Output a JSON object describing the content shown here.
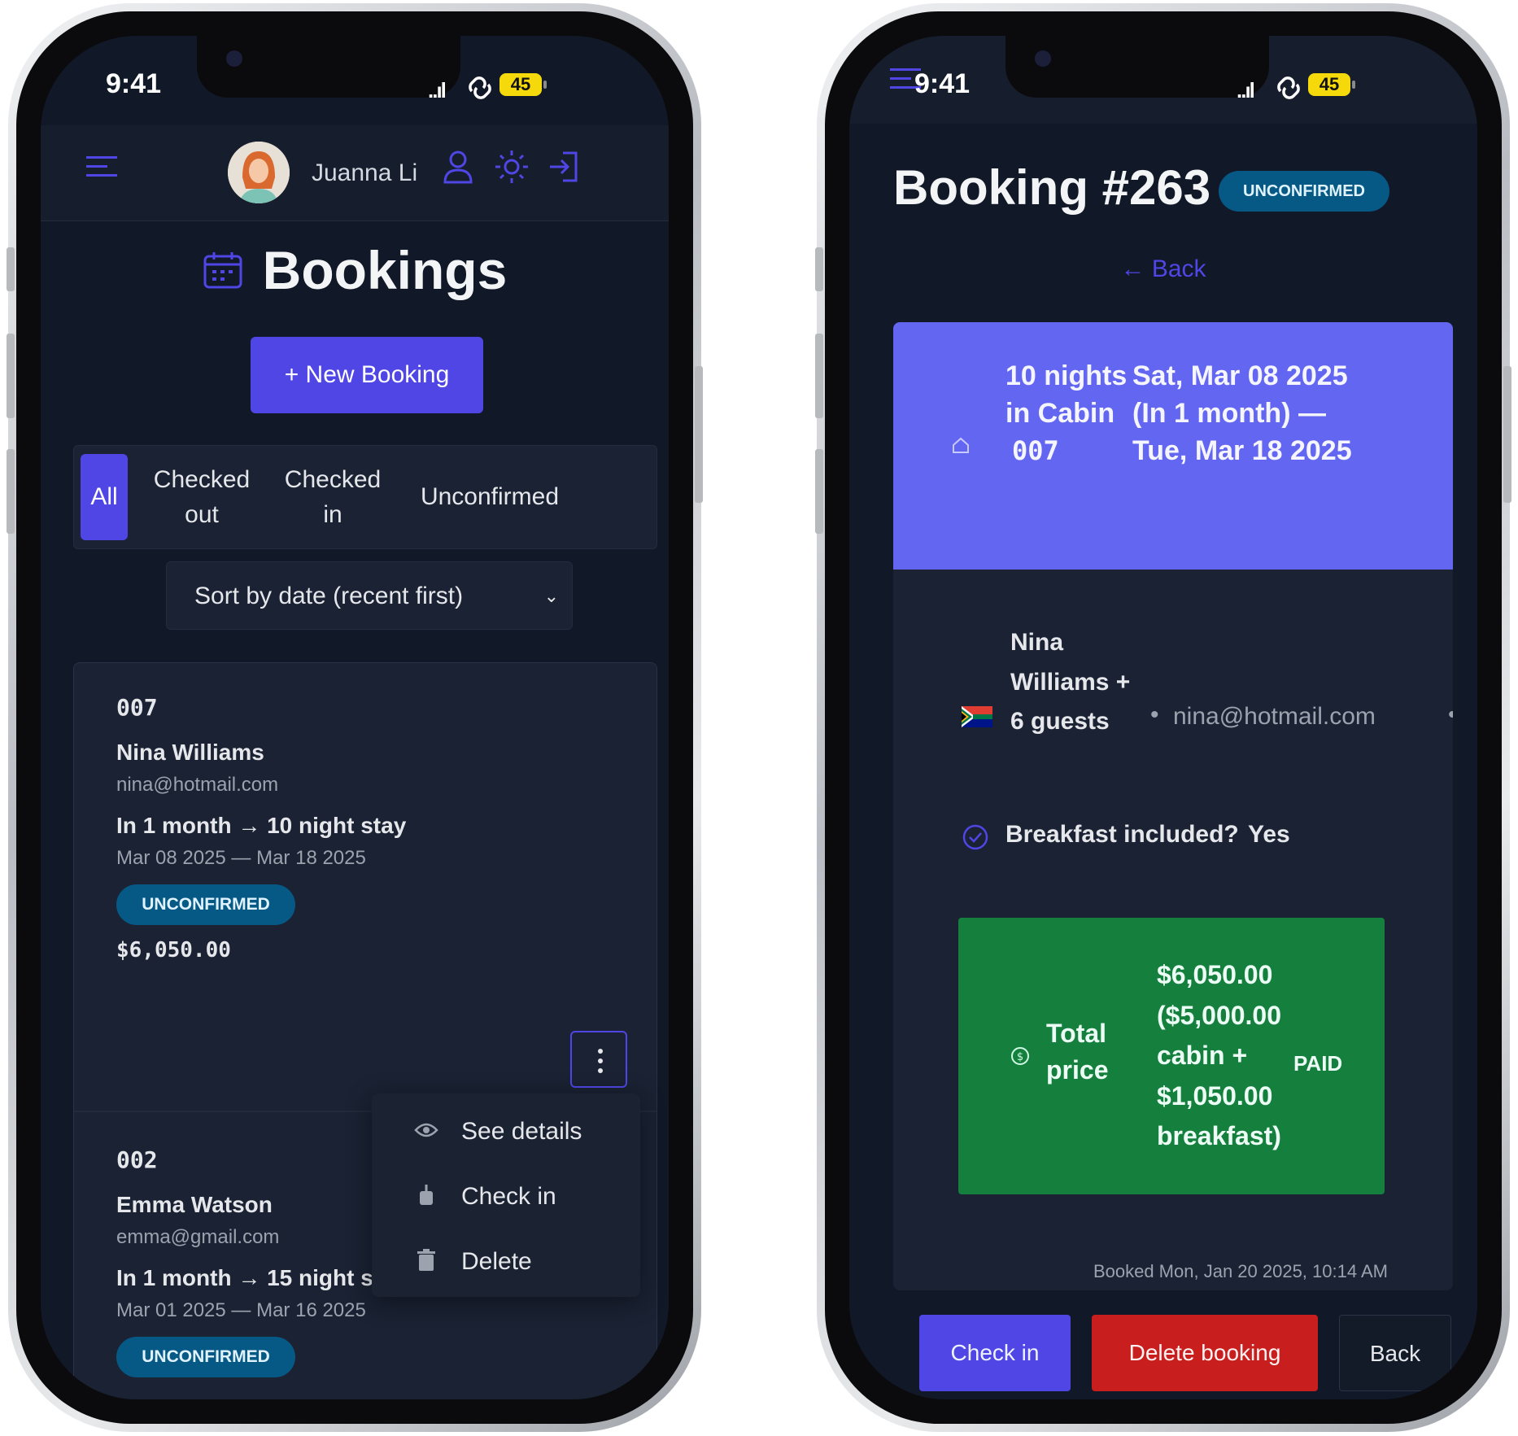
{
  "status_bar": {
    "time": "9:41",
    "signal": "..ıl",
    "battery": "45"
  },
  "bookings_screen": {
    "user": {
      "name": "Juanna Li"
    },
    "title": "Bookings",
    "new_booking_label": "+ New Booking",
    "filters": [
      {
        "label": "All",
        "active": true
      },
      {
        "label": "Checked out",
        "active": false
      },
      {
        "label": "Checked in",
        "active": false
      },
      {
        "label": "Unconfirmed",
        "active": false
      }
    ],
    "sort": {
      "selected": "Sort by date (recent first)"
    },
    "bookings": [
      {
        "cabin": "007",
        "guest": "Nina Williams",
        "email": "nina@hotmail.com",
        "stay": "In 1 month → 10 night stay",
        "dates": "Mar 08 2025 — Mar 18 2025",
        "status": "UNCONFIRMED",
        "price": "$6,050.00"
      },
      {
        "cabin": "002",
        "guest": "Emma Watson",
        "email": "emma@gmail.com",
        "stay": "In 1 month → 15 night stay",
        "dates": "Mar 01 2025 — Mar 16 2025",
        "status": "UNCONFIRMED"
      }
    ],
    "context_menu": [
      {
        "label": "See details",
        "icon": "eye-icon"
      },
      {
        "label": "Check in",
        "icon": "check-in-icon"
      },
      {
        "label": "Delete",
        "icon": "trash-icon"
      }
    ]
  },
  "detail_screen": {
    "title": "Booking #263",
    "status": "UNCONFIRMED",
    "back_link": "← Back",
    "header": {
      "nights": "10 nights in Cabin",
      "cabin": "007",
      "dates": "Sat, Mar 08 2025 (In 1 month) — Tue, Mar 18 2025"
    },
    "guest": {
      "name": "Nina Williams + 6 guests",
      "email": "nina@hotmail.com",
      "flag": "south-africa-flag-icon"
    },
    "breakfast": {
      "label": "Breakfast included?",
      "value": "Yes"
    },
    "total": {
      "label": "Total price",
      "value": "$6,050.00 ($5,000.00 cabin + $1,050.00 breakfast)",
      "paid": "PAID"
    },
    "booked_at": "Booked Mon, Jan 20 2025, 10:14 AM",
    "actions": {
      "check_in": "Check in",
      "delete": "Delete booking",
      "back": "Back"
    }
  },
  "colors": {
    "background": "#111827",
    "surface": "#1a2233",
    "accent": "#4f46e5",
    "status_badge": "#075985",
    "paid_green": "#15803d",
    "danger": "#c81e1e"
  }
}
